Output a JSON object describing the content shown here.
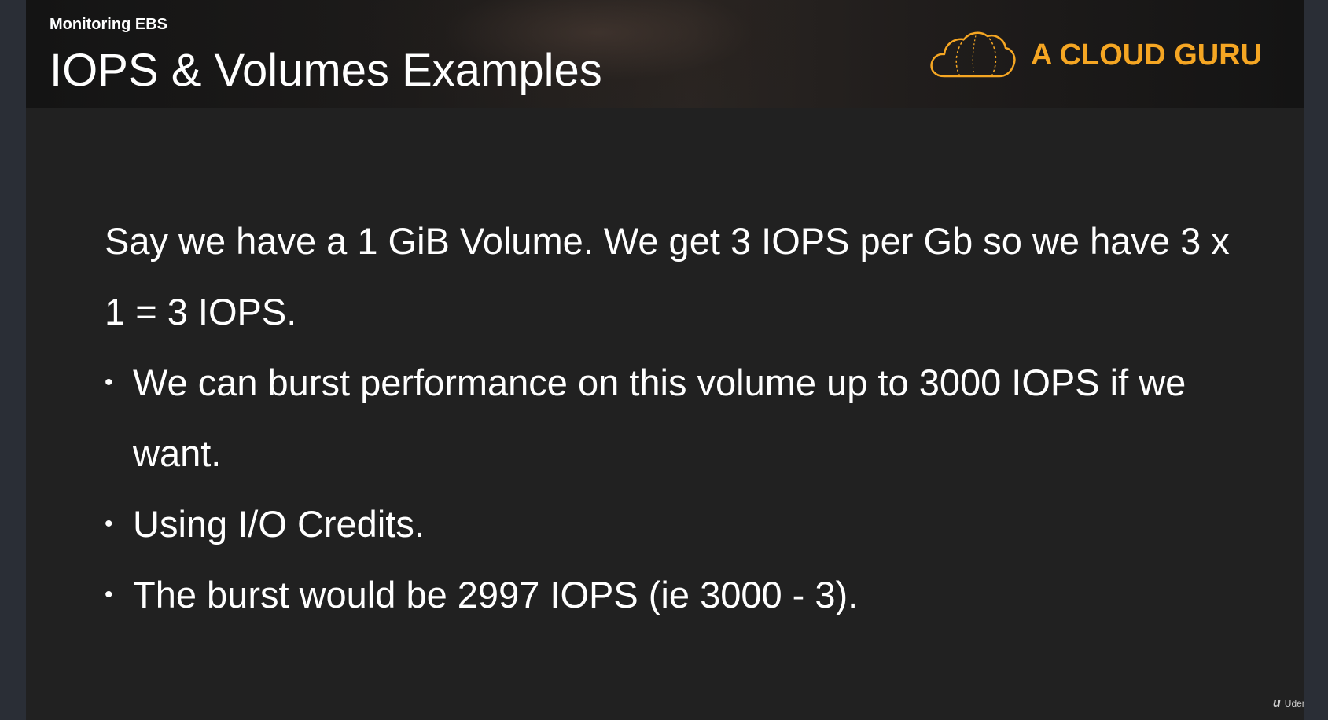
{
  "header": {
    "section": "Monitoring EBS",
    "title": "IOPS & Volumes Examples",
    "brand": "A CLOUD GURU",
    "brand_icon": "cloud-icon"
  },
  "body": {
    "paragraph": "Say we have a 1 GiB Volume. We get 3 IOPS per Gb so we have 3 x 1 = 3 IOPS.",
    "bullets": [
      "We can burst performance on this volume up to 3000 IOPS if we want.",
      "Using I/O Credits.",
      "The burst would be 2997 IOPS (ie 3000 - 3)."
    ]
  },
  "watermark": {
    "mark": "u",
    "text": "Udemy"
  },
  "colors": {
    "background": "#212121",
    "text": "#ffffff",
    "brand": "#f5a623"
  }
}
